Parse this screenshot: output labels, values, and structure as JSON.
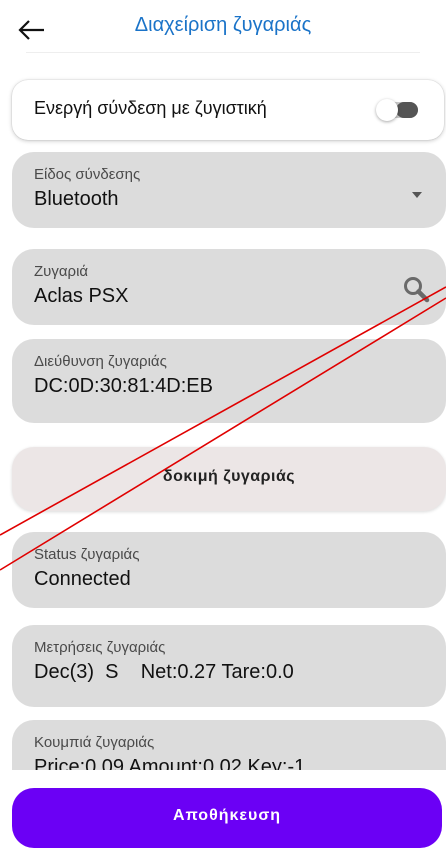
{
  "header": {
    "title": "Διαχείριση ζυγαριάς",
    "back_icon": "arrow-left-icon"
  },
  "connection_toggle": {
    "label": "Ενεργή σύνδεση με ζυγιστική",
    "enabled": false
  },
  "fields": {
    "connection_type": {
      "label": "Είδος σύνδεσης",
      "value": "Bluetooth"
    },
    "scale": {
      "label": "Ζυγαριά",
      "value": "Aclas PSX"
    },
    "scale_address": {
      "label": "Διεύθυνση ζυγαριάς",
      "value": "DC:0D:30:81:4D:EB"
    },
    "scale_status": {
      "label": "Status ζυγαριάς",
      "value": "Connected"
    },
    "scale_measurements": {
      "label": "Μετρήσεις ζυγαριάς",
      "value": "Dec(3)  S    Net:0.27 Tare:0.0"
    },
    "scale_buttons": {
      "label": "Κουμπιά ζυγαριάς",
      "value": "Price:0.09 Amount:0.02 Key:-1"
    }
  },
  "test_button": {
    "label": "δοκιμή ζυγαριάς"
  },
  "save_button": {
    "label": "Αποθήκευση"
  },
  "colors": {
    "accent": "#6b00f5",
    "title": "#1a73c8",
    "field_bg": "#dcdcdc",
    "annotation": "#e00000"
  }
}
